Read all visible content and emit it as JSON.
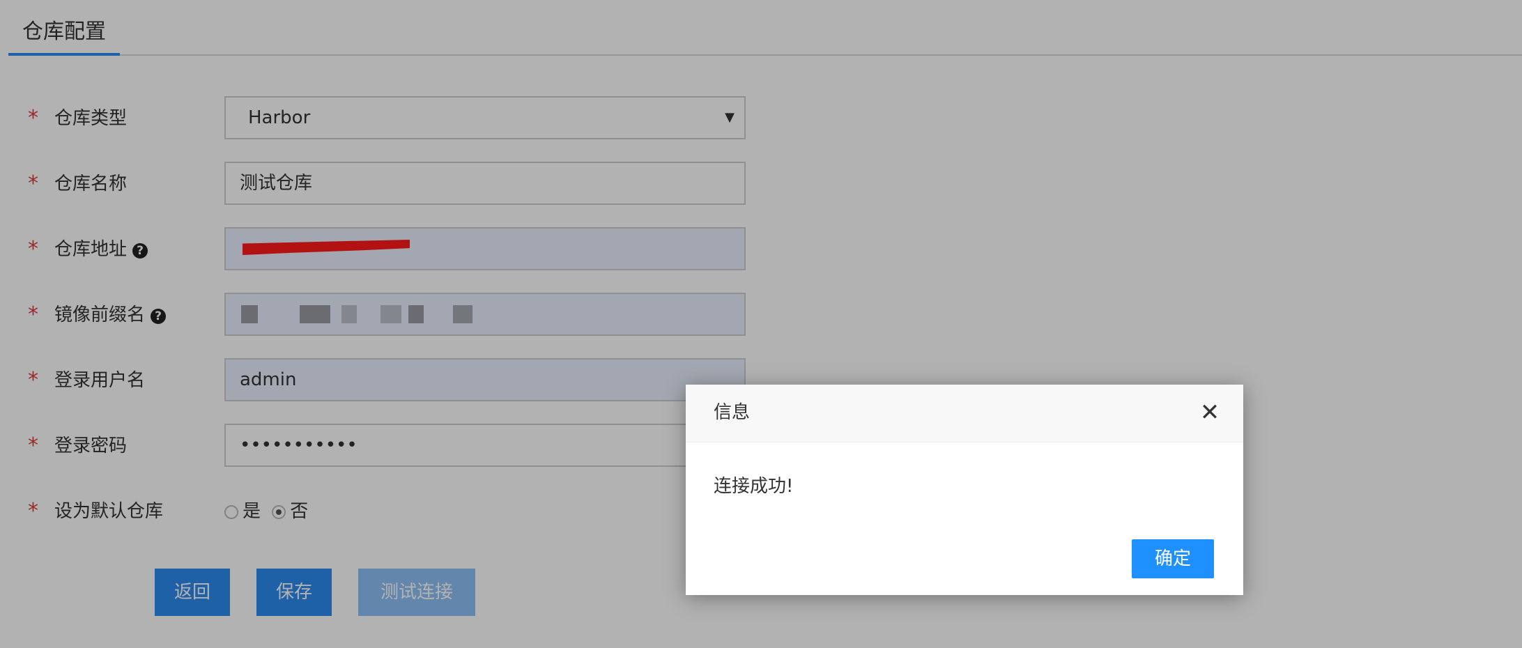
{
  "tab": {
    "label": "仓库配置"
  },
  "form": {
    "type": {
      "label": "仓库类型",
      "value": "Harbor"
    },
    "name": {
      "label": "仓库名称",
      "value": "测试仓库"
    },
    "address": {
      "label": "仓库地址"
    },
    "prefix": {
      "label": "镜像前缀名"
    },
    "username": {
      "label": "登录用户名",
      "value": "admin"
    },
    "password": {
      "label": "登录密码",
      "value": "•••••••••••"
    },
    "default": {
      "label": "设为默认仓库",
      "yes": "是",
      "no": "否",
      "selected": "否"
    },
    "required_mark": "*",
    "help_glyph": "?"
  },
  "buttons": {
    "back": "返回",
    "save": "保存",
    "test": "测试连接"
  },
  "modal": {
    "title": "信息",
    "close": "✕",
    "message": "连接成功!",
    "ok": "确定"
  },
  "colors": {
    "primary": "#2d8cf0",
    "required": "#e4393c",
    "ok_button": "#1e90ff"
  }
}
